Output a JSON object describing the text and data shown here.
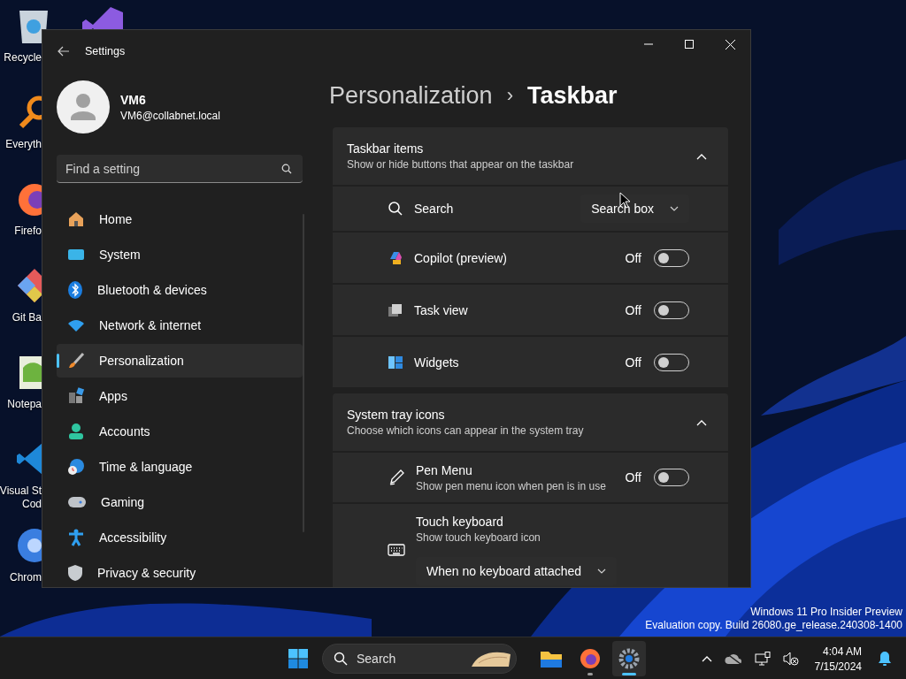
{
  "desktop_icons": [
    {
      "lines": [
        "Recycle"
      ]
    },
    {
      "lines": [
        "Everyth"
      ]
    },
    {
      "lines": [
        "Firefo"
      ]
    },
    {
      "lines": [
        "Git Ba"
      ]
    },
    {
      "lines": [
        "Notepa"
      ]
    },
    {
      "lines": [
        "Visual St",
        "Cod"
      ]
    },
    {
      "lines": [
        "Chrom"
      ]
    }
  ],
  "window": {
    "title": "Settings"
  },
  "profile": {
    "name": "VM6",
    "email": "VM6@collabnet.local"
  },
  "search": {
    "placeholder": "Find a setting"
  },
  "sidebar": {
    "items": [
      {
        "label": "Home",
        "selected": false
      },
      {
        "label": "System",
        "selected": false
      },
      {
        "label": "Bluetooth & devices",
        "selected": false
      },
      {
        "label": "Network & internet",
        "selected": false
      },
      {
        "label": "Personalization",
        "selected": true
      },
      {
        "label": "Apps",
        "selected": false
      },
      {
        "label": "Accounts",
        "selected": false
      },
      {
        "label": "Time & language",
        "selected": false
      },
      {
        "label": "Gaming",
        "selected": false
      },
      {
        "label": "Accessibility",
        "selected": false
      },
      {
        "label": "Privacy & security",
        "selected": false
      }
    ]
  },
  "breadcrumb": {
    "parent": "Personalization",
    "separator": "›",
    "current": "Taskbar"
  },
  "sections": [
    {
      "title": "Taskbar items",
      "subtitle": "Show or hide buttons that appear on the taskbar",
      "expanded": true,
      "rows": [
        {
          "kind": "dropdown",
          "label": "Search",
          "value": "Search box"
        },
        {
          "kind": "toggle",
          "label": "Copilot (preview)",
          "state": "Off",
          "on": false
        },
        {
          "kind": "toggle",
          "label": "Task view",
          "state": "Off",
          "on": false
        },
        {
          "kind": "toggle",
          "label": "Widgets",
          "state": "Off",
          "on": false
        }
      ]
    },
    {
      "title": "System tray icons",
      "subtitle": "Choose which icons can appear in the system tray",
      "expanded": true,
      "rows": [
        {
          "kind": "toggle",
          "label": "Pen Menu",
          "description": "Show pen menu icon when pen is in use",
          "state": "Off",
          "on": false
        },
        {
          "kind": "dropdown_below",
          "label": "Touch keyboard",
          "description": "Show touch keyboard icon",
          "value": "When no keyboard attached"
        }
      ]
    }
  ],
  "watermark": [
    "Windows 11 Pro Insider Preview",
    "Evaluation copy. Build 26080.ge_release.240308-1400"
  ],
  "taskbar": {
    "search": "Search",
    "apps": [
      {
        "running": false,
        "selected": false
      },
      {
        "running": true,
        "selected": false
      },
      {
        "running": true,
        "selected": true
      }
    ],
    "clock": {
      "time": "4:04 AM",
      "date": "7/15/2024"
    }
  }
}
